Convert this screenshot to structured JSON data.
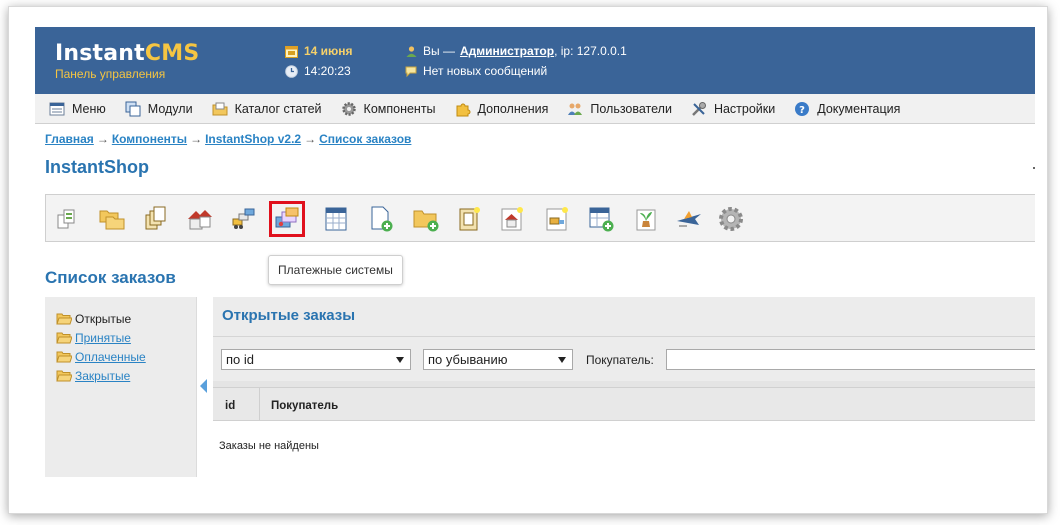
{
  "header": {
    "logo_main": "Instant",
    "logo_cms": "CMS",
    "logo_subtitle": "Панель управления",
    "date": "14 июня",
    "time": "14:20:23",
    "user_prefix": "Вы —",
    "user_name": "Администратор",
    "user_ip": ", ip: 127.0.0.1",
    "messages": "Нет новых сообщений"
  },
  "menu": {
    "items": [
      {
        "label": "Меню",
        "icon": "menu-icon"
      },
      {
        "label": "Модули",
        "icon": "modules-icon"
      },
      {
        "label": "Каталог статей",
        "icon": "catalog-icon"
      },
      {
        "label": "Компоненты",
        "icon": "gear-icon"
      },
      {
        "label": "Дополнения",
        "icon": "puzzle-icon"
      },
      {
        "label": "Пользователи",
        "icon": "users-icon"
      },
      {
        "label": "Настройки",
        "icon": "tools-icon"
      },
      {
        "label": "Документация",
        "icon": "help-icon"
      }
    ]
  },
  "breadcrumbs": [
    "Главная",
    "Компоненты",
    "InstantShop v2.2",
    "Список заказов"
  ],
  "breadcrumb_separator": "→",
  "page_title": "InstantShop",
  "toolbar": {
    "active_index": 5,
    "tooltip": "Платежные системы"
  },
  "section_title": "Список заказов",
  "sidebar": {
    "items": [
      {
        "label": "Открытые",
        "link": false
      },
      {
        "label": "Принятые",
        "link": true
      },
      {
        "label": "Оплаченные",
        "link": true
      },
      {
        "label": "Закрытые",
        "link": true
      }
    ]
  },
  "panel": {
    "title": "Открытые заказы",
    "sort_field": "по id",
    "sort_order": "по убыванию",
    "buyer_label": "Покупатель:",
    "buyer_value": ""
  },
  "table": {
    "columns": [
      "id",
      "Покупатель"
    ],
    "empty_text": "Заказы не найдены"
  }
}
